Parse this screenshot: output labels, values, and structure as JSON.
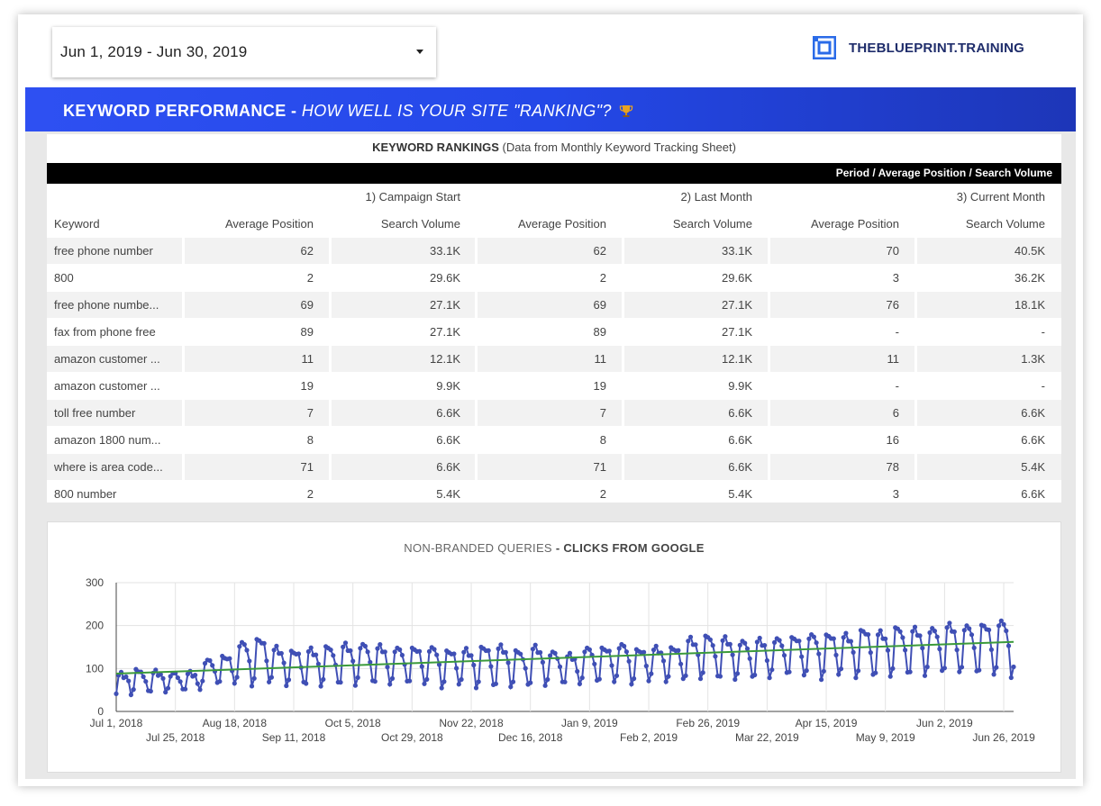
{
  "date_range": {
    "label": "Jun 1, 2019 - Jun 30, 2019"
  },
  "logo": {
    "brand": "THEBLUEPRINT",
    "suffix": ".TRAINING",
    "icon": "blueprint-logo-icon"
  },
  "banner": {
    "bold": "KEYWORD PERFORMANCE -",
    "italic": "HOW WELL IS YOUR SITE \"RANKING\"?",
    "icon": "trophy-icon"
  },
  "table": {
    "title_bold": "KEYWORD RANKINGS",
    "title_rest": "(Data from Monthly Keyword Tracking Sheet)",
    "bar_label": "Period / Average Position / Search Volume",
    "periods": [
      "1) Campaign Start",
      "2) Last Month",
      "3) Current Month"
    ],
    "col_keyword": "Keyword",
    "col_avg": "Average Position",
    "col_vol": "Search Volume",
    "rows": [
      {
        "kw": "free phone number",
        "a1": "62",
        "v1": "33.1K",
        "a2": "62",
        "v2": "33.1K",
        "a3": "70",
        "v3": "40.5K"
      },
      {
        "kw": "800",
        "a1": "2",
        "v1": "29.6K",
        "a2": "2",
        "v2": "29.6K",
        "a3": "3",
        "v3": "36.2K"
      },
      {
        "kw": "free phone numbe...",
        "a1": "69",
        "v1": "27.1K",
        "a2": "69",
        "v2": "27.1K",
        "a3": "76",
        "v3": "18.1K"
      },
      {
        "kw": "fax from phone free",
        "a1": "89",
        "v1": "27.1K",
        "a2": "89",
        "v2": "27.1K",
        "a3": "-",
        "v3": "-"
      },
      {
        "kw": "amazon customer ...",
        "a1": "11",
        "v1": "12.1K",
        "a2": "11",
        "v2": "12.1K",
        "a3": "11",
        "v3": "1.3K"
      },
      {
        "kw": "amazon customer ...",
        "a1": "19",
        "v1": "9.9K",
        "a2": "19",
        "v2": "9.9K",
        "a3": "-",
        "v3": "-"
      },
      {
        "kw": "toll free number",
        "a1": "7",
        "v1": "6.6K",
        "a2": "7",
        "v2": "6.6K",
        "a3": "6",
        "v3": "6.6K"
      },
      {
        "kw": "amazon 1800 num...",
        "a1": "8",
        "v1": "6.6K",
        "a2": "8",
        "v2": "6.6K",
        "a3": "16",
        "v3": "6.6K"
      },
      {
        "kw": "where is area code...",
        "a1": "71",
        "v1": "6.6K",
        "a2": "71",
        "v2": "6.6K",
        "a3": "78",
        "v3": "5.4K"
      },
      {
        "kw": "800 number",
        "a1": "2",
        "v1": "5.4K",
        "a2": "2",
        "v2": "5.4K",
        "a3": "3",
        "v3": "6.6K"
      }
    ]
  },
  "chart_title": {
    "light": "NON-BRANDED QUERIES",
    "bold": "- CLICKS FROM GOOGLE"
  },
  "chart_data": {
    "type": "line",
    "title": "NON-BRANDED QUERIES - CLICKS FROM GOOGLE",
    "xlabel": "",
    "ylabel": "",
    "ylim": [
      0,
      300
    ],
    "yticks": [
      "0",
      "100",
      "200",
      "300"
    ],
    "xlim": [
      "2018-07-01",
      "2019-06-30"
    ],
    "xticks_row1": [
      "Jul 1, 2018",
      "Aug 18, 2018",
      "Oct 5, 2018",
      "Nov 22, 2018",
      "Jan 9, 2019",
      "Feb 26, 2019",
      "Apr 15, 2019",
      "Jun 2, 2019"
    ],
    "xticks_row2": [
      "Jul 25, 2018",
      "Sep 11, 2018",
      "Oct 29, 2018",
      "Dec 16, 2018",
      "Feb 2, 2019",
      "Mar 22, 2019",
      "May 9, 2019",
      "Jun 26, 2019"
    ],
    "grid": true,
    "series": [
      {
        "color": "#3f4fb5",
        "start": "2018-07-01",
        "period_days": 7,
        "weekly_peaks": [
          88,
          95,
          92,
          90,
          88,
          120,
          130,
          160,
          170,
          150,
          140,
          145,
          150,
          155,
          158,
          150,
          148,
          150,
          148,
          142,
          145,
          150,
          152,
          140,
          150,
          140,
          130,
          148,
          150,
          155,
          145,
          150,
          148,
          170,
          175,
          170,
          165,
          165,
          170,
          175,
          178,
          180,
          180,
          190,
          185,
          195,
          192,
          195,
          200,
          200,
          205,
          210,
          235,
          205,
          200,
          195,
          190,
          165
        ],
        "weekly_troughs": [
          40,
          42,
          45,
          45,
          50,
          58,
          62,
          60,
          62,
          60,
          62,
          58,
          60,
          58,
          62,
          60,
          60,
          60,
          56,
          58,
          55,
          55,
          56,
          55,
          58,
          60,
          62,
          62,
          65,
          65,
          66,
          70,
          70,
          75,
          74,
          72,
          72,
          75,
          80,
          80,
          75,
          80,
          78,
          78,
          80,
          82,
          80,
          85,
          88,
          82,
          80,
          78,
          82,
          80,
          78,
          75,
          80,
          75
        ]
      },
      {
        "name": "trend",
        "color": "#3b9a3b",
        "start_value": 88,
        "end_value": 162
      }
    ]
  }
}
